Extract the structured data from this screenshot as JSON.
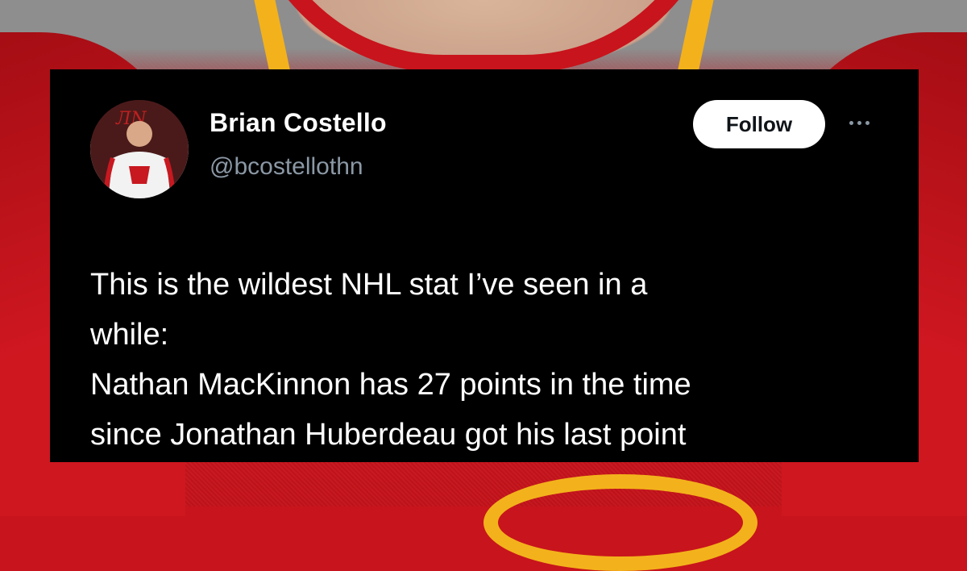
{
  "tweet": {
    "author": {
      "display_name": "Brian Costello",
      "handle": "@bcostellothn",
      "avatar_icon": "profile-photo"
    },
    "follow_label": "Follow",
    "more_icon": "ellipsis-icon",
    "text_lines": [
      "This is the wildest NHL stat I’ve seen in a",
      "while:",
      "Nathan MacKinnon has 27 points in the time",
      "since Jonathan Huberdeau got his last point"
    ]
  },
  "colors": {
    "card_bg": "#000000",
    "handle": "#8b98a5",
    "follow_bg": "#ffffff",
    "jersey_red": "#c8141c",
    "jersey_gold": "#f3b21b"
  }
}
